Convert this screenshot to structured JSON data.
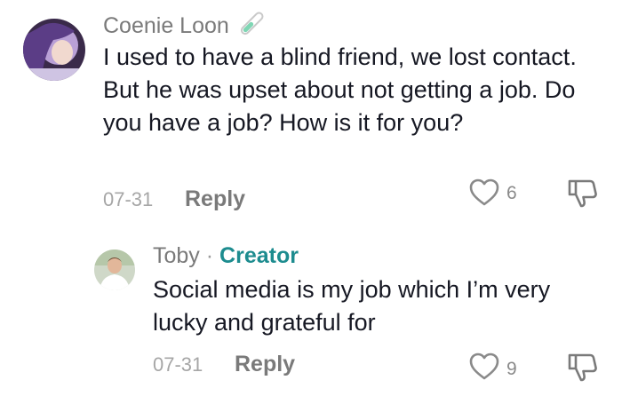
{
  "comments": [
    {
      "author": "Coenie Loon",
      "author_badge_icon": "test-tube-icon",
      "text": "I used to have a blind friend, we lost contact. But he was upset about not getting a job. Do you have a job? How is it for you?",
      "date": "07-31",
      "reply_label": "Reply",
      "like_count": "6",
      "colors": {
        "username": "#7a7a7a",
        "text": "#161823"
      }
    },
    {
      "author": "Toby",
      "separator": "·",
      "author_tag": "Creator",
      "text": "Social media is my job which I’m very lucky and grateful for",
      "date": "07-31",
      "reply_label": "Reply",
      "like_count": "9",
      "colors": {
        "creator_tag": "#1d8c8f"
      }
    }
  ],
  "icons": {
    "like": "heart-outline-icon",
    "dislike": "thumbs-down-outline-icon"
  }
}
